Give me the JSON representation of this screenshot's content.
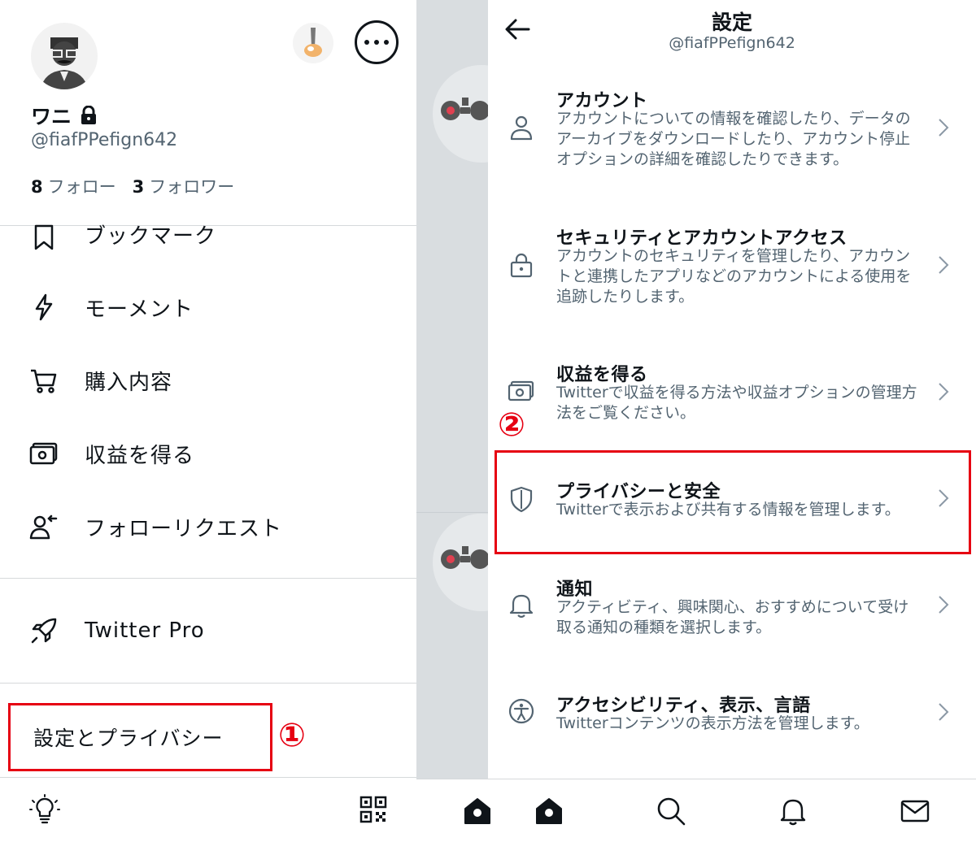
{
  "left": {
    "name": "ワニ",
    "handle": "@fiafPPefign642",
    "following_count": "8",
    "following_label": "フォロー",
    "followers_count": "3",
    "followers_label": "フォロワー",
    "menu": [
      {
        "label": "ブックマーク",
        "icon": "bookmark-icon"
      },
      {
        "label": "モーメント",
        "icon": "lightning-icon"
      },
      {
        "label": "購入内容",
        "icon": "cart-icon"
      },
      {
        "label": "収益を得る",
        "icon": "money-icon"
      },
      {
        "label": "フォローリクエスト",
        "icon": "follow-request-icon"
      }
    ],
    "pro_label": "Twitter Pro",
    "settings_label": "設定とプライバシー",
    "step1": "①"
  },
  "right": {
    "title": "設定",
    "subtitle": "@fiafPPefign642",
    "step2": "②",
    "items": [
      {
        "title": "アカウント",
        "desc": "アカウントについての情報を確認したり、データのアーカイブをダウンロードしたり、アカウント停止オプションの詳細を確認したりできます。",
        "icon": "person-icon"
      },
      {
        "title": "セキュリティとアカウントアクセス",
        "desc": "アカウントのセキュリティを管理したり、アカウントと連携したアプリなどのアカウントによる使用を追跡したりします。",
        "icon": "lock-icon"
      },
      {
        "title": "収益を得る",
        "desc": "Twitterで収益を得る方法や収益オプションの管理方法をご覧ください。",
        "icon": "money-icon"
      },
      {
        "title": "プライバシーと安全",
        "desc": "Twitterで表示および共有する情報を管理します。",
        "icon": "shield-icon"
      },
      {
        "title": "通知",
        "desc": "アクティビティ、興味関心、おすすめについて受け取る通知の種類を選択します。",
        "icon": "bell-icon"
      },
      {
        "title": "アクセシビリティ、表示、言語",
        "desc": "Twitterコンテンツの表示方法を管理します。",
        "icon": "accessibility-icon"
      }
    ]
  },
  "colors": {
    "highlight": "#e60012",
    "text": "#0f1419",
    "muted": "#536471",
    "divider": "#d6d9db"
  }
}
